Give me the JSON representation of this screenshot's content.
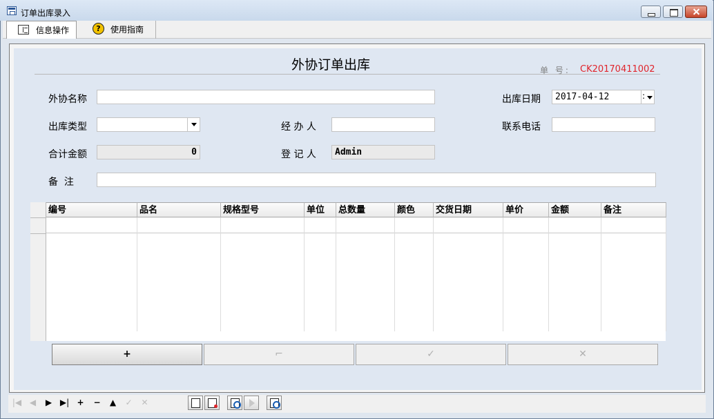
{
  "window": {
    "title": "订单出库录入"
  },
  "tabs": [
    {
      "label": "信息操作",
      "icon": "info-panel-icon"
    },
    {
      "label": "使用指南",
      "icon": "help-icon"
    }
  ],
  "form": {
    "title": "外协订单出库",
    "order_no_label": "单 号:",
    "order_no": "CK20170411002",
    "fields": {
      "partner_label": "外协名称",
      "partner_value": "",
      "out_date_label": "出库日期",
      "out_date_value": "2017-04-12",
      "out_type_label": "出库类型",
      "out_type_value": "",
      "handler_label": "经 办 人",
      "handler_value": "",
      "phone_label": "联系电话",
      "phone_value": "",
      "total_label": "合计金额",
      "total_value": "0",
      "recorder_label": "登 记 人",
      "recorder_value": "Admin",
      "remark_label": "备  注",
      "remark_value": ""
    }
  },
  "grid": {
    "columns": [
      "编号",
      "品名",
      "规格型号",
      "单位",
      "总数量",
      "颜色",
      "交货日期",
      "单价",
      "金额",
      "备注"
    ]
  },
  "actions": {
    "add": "+",
    "edit": "⌐",
    "save": "✓",
    "delete": "✕"
  },
  "navigator": [
    "|◀",
    "◀",
    "▶",
    "▶|",
    "+",
    "−",
    "▲",
    "✓",
    "✕"
  ],
  "colors": {
    "order_no": "#e0242b",
    "panel_bg": "#dfe7f2"
  }
}
